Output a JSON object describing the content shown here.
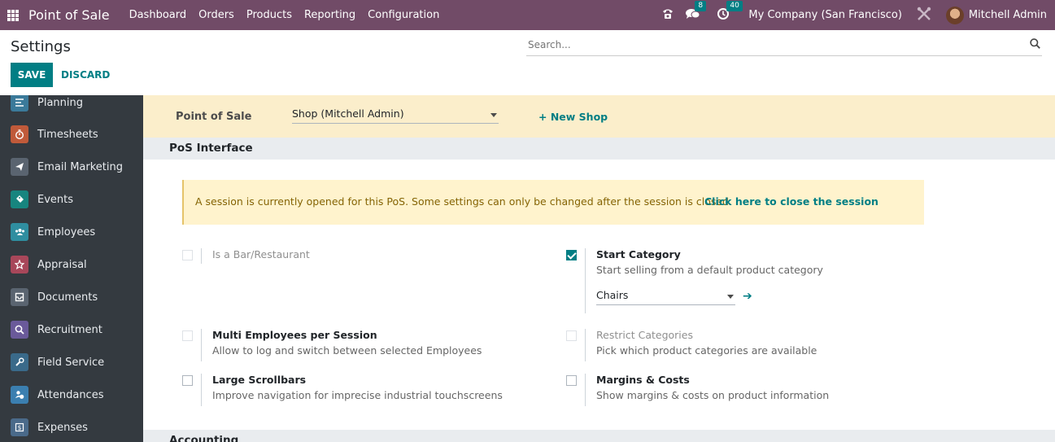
{
  "navbar": {
    "app_name": "Point of Sale",
    "menu": [
      "Dashboard",
      "Orders",
      "Products",
      "Reporting",
      "Configuration"
    ],
    "messages_count": "8",
    "activities_count": "40",
    "company": "My Company (San Francisco)",
    "user": "Mitchell Admin"
  },
  "control_panel": {
    "title": "Settings",
    "search_placeholder": "Search...",
    "save_label": "SAVE",
    "discard_label": "DISCARD"
  },
  "sidebar": {
    "items": [
      {
        "label": "Planning",
        "icon": "planning-icon",
        "color": "#3b7a9a"
      },
      {
        "label": "Timesheets",
        "icon": "stopwatch-icon",
        "color": "#c05a3a"
      },
      {
        "label": "Email Marketing",
        "icon": "paper-plane-icon",
        "color": "#5a6470"
      },
      {
        "label": "Events",
        "icon": "ticket-icon",
        "color": "#17857f"
      },
      {
        "label": "Employees",
        "icon": "users-icon",
        "color": "#2f8ea0"
      },
      {
        "label": "Appraisal",
        "icon": "star-icon",
        "color": "#a8475a"
      },
      {
        "label": "Documents",
        "icon": "inbox-icon",
        "color": "#5a6470"
      },
      {
        "label": "Recruitment",
        "icon": "search-person-icon",
        "color": "#6a5a9a"
      },
      {
        "label": "Field Service",
        "icon": "wrench-icon",
        "color": "#3a6a8a"
      },
      {
        "label": "Attendances",
        "icon": "user-clock-icon",
        "color": "#3b7fb0"
      },
      {
        "label": "Expenses",
        "icon": "money-icon",
        "color": "#4a6a8a"
      }
    ]
  },
  "main": {
    "pos_label": "Point of Sale",
    "pos_value": "Shop (Mitchell Admin)",
    "new_shop": "+ New Shop",
    "section_pos_interface": "PoS Interface",
    "alert_text": "A session is currently opened for this PoS. Some settings can only be changed after the session is closed.",
    "alert_link": "Click here to close the session",
    "settings": {
      "bar_restaurant": {
        "title": "Is a Bar/Restaurant",
        "checked": false
      },
      "start_category": {
        "title": "Start Category",
        "desc": "Start selling from a default product category",
        "value": "Chairs",
        "checked": true
      },
      "multi_employees": {
        "title": "Multi Employees per Session",
        "desc": "Allow to log and switch between selected Employees",
        "checked": false
      },
      "restrict_categories": {
        "title": "Restrict Categories",
        "desc": "Pick which product categories are available",
        "checked": false
      },
      "large_scrollbars": {
        "title": "Large Scrollbars",
        "desc": "Improve navigation for imprecise industrial touchscreens",
        "checked": false
      },
      "margins_costs": {
        "title": "Margins & Costs",
        "desc": "Show margins & costs on product information",
        "checked": false
      }
    },
    "section_accounting": "Accounting"
  },
  "colors": {
    "navbar": "#714b67",
    "primary": "#017e84",
    "sidebar": "#343a40",
    "pos_bar": "#fbeecb",
    "alert_bg": "#fff3cd",
    "alert_text": "#856404"
  }
}
